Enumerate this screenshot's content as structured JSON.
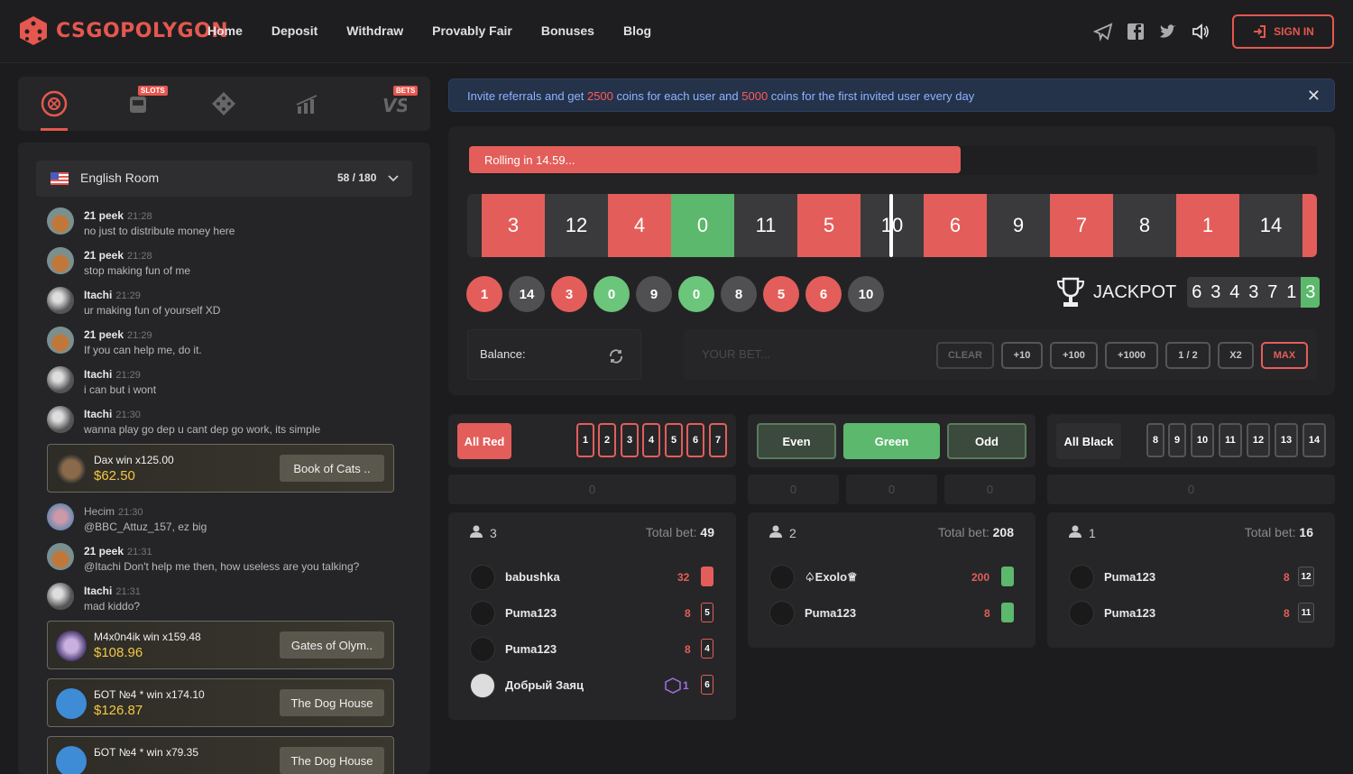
{
  "header": {
    "logo_text": "CSGOPOLYGON",
    "nav": [
      "Home",
      "Deposit",
      "Withdraw",
      "Provably Fair",
      "Bonuses",
      "Blog"
    ],
    "sign_in": "SIGN IN"
  },
  "game_tabs": {
    "slots_badge": "SLOTS",
    "bets_badge": "BETS"
  },
  "chat": {
    "room": {
      "name": "English Room",
      "count": "58 / 180"
    },
    "messages": [
      {
        "name": "21 peek",
        "time": "21:28",
        "text": "no just to distribute money here"
      },
      {
        "name": "21 peek",
        "time": "21:28",
        "text": "stop making fun of me"
      },
      {
        "name": "Itachi",
        "time": "21:29",
        "text": "ur making fun of yourself XD"
      },
      {
        "name": "21 peek",
        "time": "21:29",
        "text": "If you can help me, do it."
      },
      {
        "name": "Itachi",
        "time": "21:29",
        "text": "i can but i wont"
      },
      {
        "name": "Itachi",
        "time": "21:30",
        "text": "wanna play go dep u cant dep go work, its simple"
      },
      {
        "name": "Hecim",
        "time": "21:30",
        "text": "@BBC_Attuz_157, ez big"
      },
      {
        "name": "21 peek",
        "time": "21:31",
        "text": "@Itachi Don't help me then, how useless are you talking?"
      },
      {
        "name": "Itachi",
        "time": "21:31",
        "text": "mad kiddo?"
      }
    ],
    "wins": [
      {
        "title": "Dax win x125.00",
        "amount": "$62.50",
        "game": "Book of Cats .."
      },
      {
        "title": "M4x0n4ik win x159.48",
        "amount": "$108.96",
        "game": "Gates of Olym.."
      },
      {
        "title": "БОТ №4 * win x174.10",
        "amount": "$126.87",
        "game": "The Dog House"
      },
      {
        "title": "БОТ №4 * win x79.35",
        "amount": "",
        "game": "The Dog House"
      }
    ]
  },
  "banner": {
    "p1": "Invite referrals and get ",
    "v1": "2500",
    "p2": " coins for each user and ",
    "v2": "5000",
    "p3": " coins for the first invited user every day"
  },
  "roll": {
    "text": "Rolling in 14.59...",
    "progress": 0.58
  },
  "strip": [
    {
      "n": "3",
      "c": "r"
    },
    {
      "n": "12",
      "c": "b"
    },
    {
      "n": "4",
      "c": "r"
    },
    {
      "n": "0",
      "c": "g"
    },
    {
      "n": "11",
      "c": "b"
    },
    {
      "n": "5",
      "c": "r"
    },
    {
      "n": "10",
      "c": "b"
    },
    {
      "n": "6",
      "c": "r"
    },
    {
      "n": "9",
      "c": "b"
    },
    {
      "n": "7",
      "c": "r"
    },
    {
      "n": "8",
      "c": "b"
    },
    {
      "n": "1",
      "c": "r"
    },
    {
      "n": "14",
      "c": "b"
    }
  ],
  "history": [
    {
      "n": "1",
      "c": "r"
    },
    {
      "n": "14",
      "c": "b"
    },
    {
      "n": "3",
      "c": "r"
    },
    {
      "n": "0",
      "c": "g"
    },
    {
      "n": "9",
      "c": "b"
    },
    {
      "n": "0",
      "c": "g"
    },
    {
      "n": "8",
      "c": "b"
    },
    {
      "n": "5",
      "c": "r"
    },
    {
      "n": "6",
      "c": "r"
    },
    {
      "n": "10",
      "c": "b"
    }
  ],
  "jackpot": {
    "label": "JACKPOT",
    "digits": [
      "6",
      "3",
      "4",
      "3",
      "7",
      "1",
      "3"
    ]
  },
  "bet": {
    "balance_label": "Balance:",
    "placeholder": "YOUR BET...",
    "buttons": [
      "CLEAR",
      "+10",
      "+100",
      "+1000",
      "1 / 2",
      "X2",
      "MAX"
    ]
  },
  "sections": {
    "red": {
      "label": "All Red",
      "numbers": [
        "1",
        "2",
        "3",
        "4",
        "5",
        "6",
        "7"
      ],
      "count": "0"
    },
    "mid": {
      "even": "Even",
      "green": "Green",
      "odd": "Odd",
      "counts": [
        "0",
        "0",
        "0"
      ]
    },
    "black": {
      "label": "All Black",
      "numbers": [
        "8",
        "9",
        "10",
        "11",
        "12",
        "13",
        "14"
      ],
      "count": "0"
    }
  },
  "panels": [
    {
      "players": "3",
      "total_label": "Total bet: ",
      "total": "49",
      "rows": [
        {
          "name": "babushka",
          "amt": "32",
          "ind": "",
          "c": "rf"
        },
        {
          "name": "Puma123",
          "amt": "8",
          "ind": "5",
          "c": "r"
        },
        {
          "name": "Puma123",
          "amt": "8",
          "ind": "4",
          "c": "r"
        },
        {
          "name": "Добрый Заяц",
          "amt": "1",
          "ind": "6",
          "c": "r"
        }
      ]
    },
    {
      "players": "2",
      "total_label": "Total bet: ",
      "total": "208",
      "rows": [
        {
          "name": "♤Exolo♕",
          "amt": "200",
          "ind": "",
          "c": "g"
        },
        {
          "name": "Puma123",
          "amt": "8",
          "ind": "",
          "c": "g"
        }
      ]
    },
    {
      "players": "1",
      "total_label": "Total bet: ",
      "total": "16",
      "rows": [
        {
          "name": "Puma123",
          "amt": "8",
          "ind": "12",
          "c": "b"
        },
        {
          "name": "Puma123",
          "amt": "8",
          "ind": "11",
          "c": "b"
        }
      ]
    }
  ],
  "colors": {
    "accent": "#e5574f",
    "red": "#e35e5a",
    "green": "#5cb86c",
    "black": "#3a3a3c",
    "banner_text": "#8fb3ff"
  }
}
